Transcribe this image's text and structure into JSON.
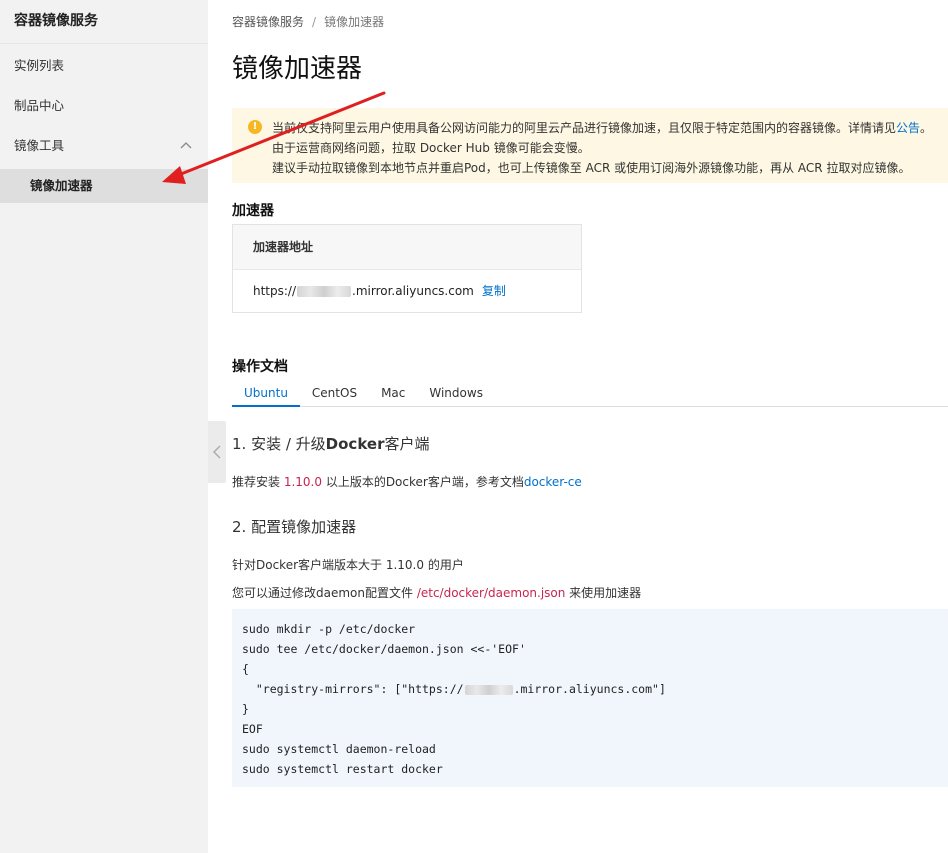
{
  "sidebar": {
    "title": "容器镜像服务",
    "items": [
      {
        "label": "实例列表"
      },
      {
        "label": "制品中心"
      },
      {
        "label": "镜像工具"
      }
    ],
    "sub_item": {
      "label": "镜像加速器"
    }
  },
  "breadcrumb": {
    "root": "容器镜像服务",
    "sep": "/",
    "current": "镜像加速器"
  },
  "page_title": "镜像加速器",
  "notice": {
    "line1_text": "当前仅支持阿里云用户使用具备公网访问能力的阿里云产品进行镜像加速，且仅限于特定范围内的容器镜像。详情请见",
    "line1_link": "公告",
    "line1_end": "。",
    "line2": "由于运营商网络问题，拉取 Docker Hub 镜像可能会变慢。",
    "line3": "建议手动拉取镜像到本地节点并重启Pod，也可上传镜像至 ACR 或使用订阅海外源镜像功能，再从 ACR 拉取对应镜像。"
  },
  "accelerator": {
    "section_title": "加速器",
    "column_header": "加速器地址",
    "url_prefix": "https://",
    "url_suffix": ".mirror.aliyuncs.com",
    "copy_label": "复制"
  },
  "docs": {
    "section_title": "操作文档",
    "tabs": [
      {
        "label": "Ubuntu",
        "active": true
      },
      {
        "label": "CentOS"
      },
      {
        "label": "Mac"
      },
      {
        "label": "Windows"
      }
    ]
  },
  "step1": {
    "heading_pre": "1. 安装 / 升级",
    "heading_bold": "Docker",
    "heading_post": "客户端",
    "text_pre": "推荐安装 ",
    "version": "1.10.0",
    "text_mid": " 以上版本的Docker客户端，参考文档",
    "doc_link": "docker-ce"
  },
  "step2": {
    "heading": "2. 配置镜像加速器",
    "line1": "针对Docker客户端版本大于 1.10.0 的用户",
    "line2_pre": "您可以通过修改daemon配置文件 ",
    "config_path": "/etc/docker/daemon.json",
    "line2_post": " 来使用加速器"
  },
  "code": {
    "lines": [
      "sudo mkdir -p /etc/docker",
      "sudo tee /etc/docker/daemon.json <<-'EOF'",
      "{"
    ],
    "mirror_pre": "  \"registry-mirrors\": [\"https://",
    "mirror_post": ".mirror.aliyuncs.com\"]",
    "lines_after": [
      "}",
      "EOF",
      "sudo systemctl daemon-reload",
      "sudo systemctl restart docker"
    ]
  },
  "colors": {
    "accent": "#0070cc",
    "warning": "#f5b823",
    "notice_bg": "#fdf7e3",
    "arrow": "#e02020",
    "code_bg": "#f0f6fc"
  },
  "icons": [
    "warning-icon",
    "chevron-up-icon",
    "chevron-left-icon",
    "arrow-annotation"
  ]
}
